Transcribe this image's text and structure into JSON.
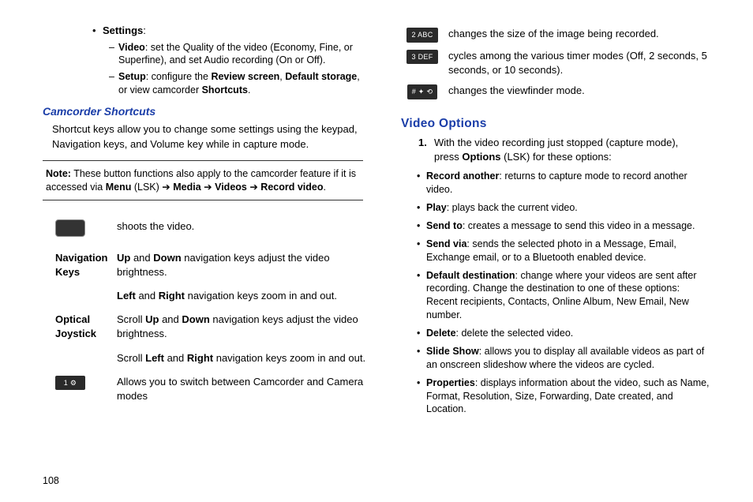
{
  "left": {
    "settings_label": "Settings",
    "video_label": "Video",
    "video_desc": ": set the Quality of the video (Economy, Fine, or Superfine), and set Audio recording (On or Off).",
    "setup_label": "Setup",
    "setup_desc_1": ": configure the ",
    "review_screen": "Review screen",
    "setup_comma": ", ",
    "default_storage": "Default storage",
    "setup_desc_2": ", or view camcorder ",
    "shortcuts": "Shortcuts",
    "period": ".",
    "camcorder_heading": "Camcorder Shortcuts",
    "camcorder_para": "Shortcut keys allow you to change some settings using the keypad, Navigation keys, and Volume key while in capture mode.",
    "note_label": "Note:",
    "note_1": " These button functions also apply to the camcorder feature if it is accessed via ",
    "menu": "Menu",
    "lsk": " (LSK) ",
    "arrow": "➔",
    "media": " Media ",
    "videos": " Videos ",
    "record_video": " Record video",
    "row1_desc": "shoots the video.",
    "row2_label": "Navigation Keys",
    "up": "Up",
    "and": " and ",
    "down": "Down",
    "row2_desc_tail": " navigation keys adjust the video brightness.",
    "left_b": "Left",
    "right_b": "Right",
    "row2b_desc_tail": " navigation keys zoom in and out.",
    "row3_label": "Optical Joystick",
    "scroll": "Scroll ",
    "row3_desc_tail": " navigation keys adjust the video brightness.",
    "row3b_desc_tail": " navigation keys zoom in and out.",
    "key1_icon": "1 ⚙",
    "row4_desc": "Allows you to switch between Camcorder and Camera modes"
  },
  "right": {
    "key2_icon": "2 ABC",
    "key2_desc": "changes the size of the image being recorded.",
    "key3_icon": "3 DEF",
    "key3_desc": "cycles among the various timer modes (Off, 2 seconds, 5 seconds, or 10 seconds).",
    "key4_icon": "# ✦ ⟲",
    "key4_desc": "changes the viewfinder mode.",
    "video_options_heading": "Video Options",
    "step1_num": "1.",
    "step1_line1": "With the video recording just stopped (capture mode),",
    "step1_line2a": "press ",
    "options_b": "Options",
    "step1_line2b": " (LSK) for these options:",
    "opt_record_b": "Record another",
    "opt_record_d": ": returns to capture mode to record another video.",
    "opt_play_b": "Play",
    "opt_play_d": ": plays back the current video.",
    "opt_sendto_b": "Send to",
    "opt_sendto_d": ": creates a message to send this video in a message.",
    "opt_sendvia_b": "Send via",
    "opt_sendvia_d": ": sends the selected photo in a Message, Email, Exchange email, or to a Bluetooth enabled device.",
    "opt_defaultdest_b": "Default destination",
    "opt_defaultdest_d": ": change where your videos are sent after recording. Change the destination to one of these options: Recent recipients, Contacts, Online Album, New Email, New number.",
    "opt_delete_b": "Delete",
    "opt_delete_d": ": delete the selected video.",
    "opt_slideshow_b": "Slide Show",
    "opt_slideshow_d": ": allows you to display all available videos as part of an onscreen slideshow where the videos are cycled.",
    "opt_props_b": "Properties",
    "opt_props_d": ": displays information about the video, such as Name, Format, Resolution, Size, Forwarding, Date created, and Location."
  },
  "page_number": "108"
}
